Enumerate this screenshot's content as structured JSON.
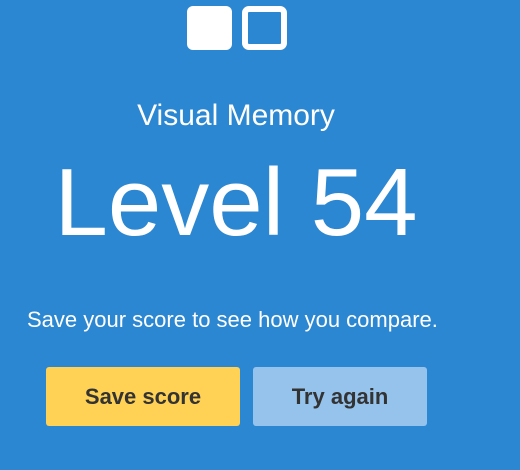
{
  "app": {
    "logo_icon": "two-squares-icon",
    "accent_color": "#2b87d1"
  },
  "result": {
    "test_name": "Visual Memory",
    "level_text": "Level 54",
    "prompt": "Save your score to see how you compare."
  },
  "actions": {
    "save_label": "Save score",
    "save_color": "#ffd154",
    "try_again_label": "Try again",
    "try_again_color": "#95c3eb"
  }
}
